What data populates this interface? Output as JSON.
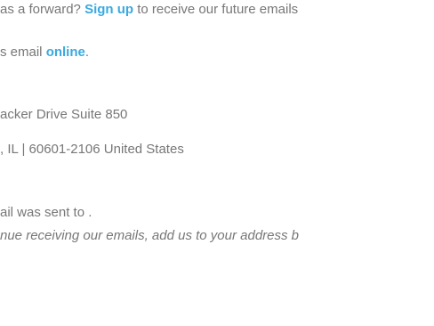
{
  "forward_notice": {
    "prefix": "as a forward?",
    "signup_link": "Sign up",
    "suffix": "to receive our future emails"
  },
  "view_online": {
    "prefix": "s email",
    "link": "online",
    "suffix": "."
  },
  "address": {
    "line1": "acker Drive Suite 850",
    "line2": ", IL | 60601-2106 United States"
  },
  "sent_to": {
    "text": "ail was sent to ."
  },
  "address_book_notice": {
    "text": "nue receiving our emails, add us to your address b"
  }
}
